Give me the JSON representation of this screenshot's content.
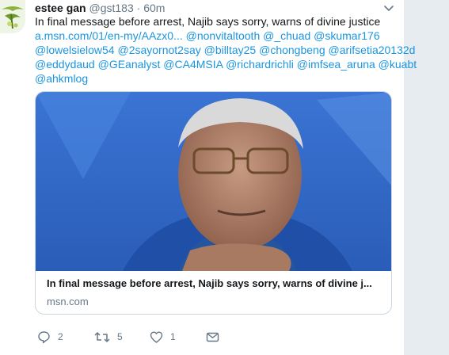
{
  "tweet": {
    "display_name": "estee gan",
    "handle": "@gst183",
    "separator": "·",
    "time": "60m",
    "text_line1": "In final message before arrest, Najib says sorry, warns of divine justice",
    "link_url": "a.msn.com/01/en-my/AAzx0...",
    "mentions_line2": "@nonvitaltooth @_chuad @skumar176",
    "mentions_line3": "@lowelsielow54 @2sayornot2say @billtay25 @chongbeng @arifsetia20132d",
    "mentions_line4": "@eddydaud @GEanalyst @CA4MSIA @richardrichli @imfsea_aruna @kuabt",
    "mentions_line5": "@ahkmlog"
  },
  "card": {
    "title": "In final message before arrest, Najib says sorry, warns of divine j...",
    "domain": "msn.com"
  },
  "actions": {
    "reply_count": "2",
    "retweet_count": "5",
    "like_count": "1",
    "reply_icon": "reply-icon",
    "retweet_icon": "retweet-icon",
    "like_icon": "heart-icon",
    "dm_icon": "envelope-icon"
  },
  "colors": {
    "link": "#1b95e0",
    "muted": "#657786",
    "border": "#ccd6dd",
    "side_background": "#e6ecf0",
    "card_photo_blue": "#2f68c9"
  }
}
